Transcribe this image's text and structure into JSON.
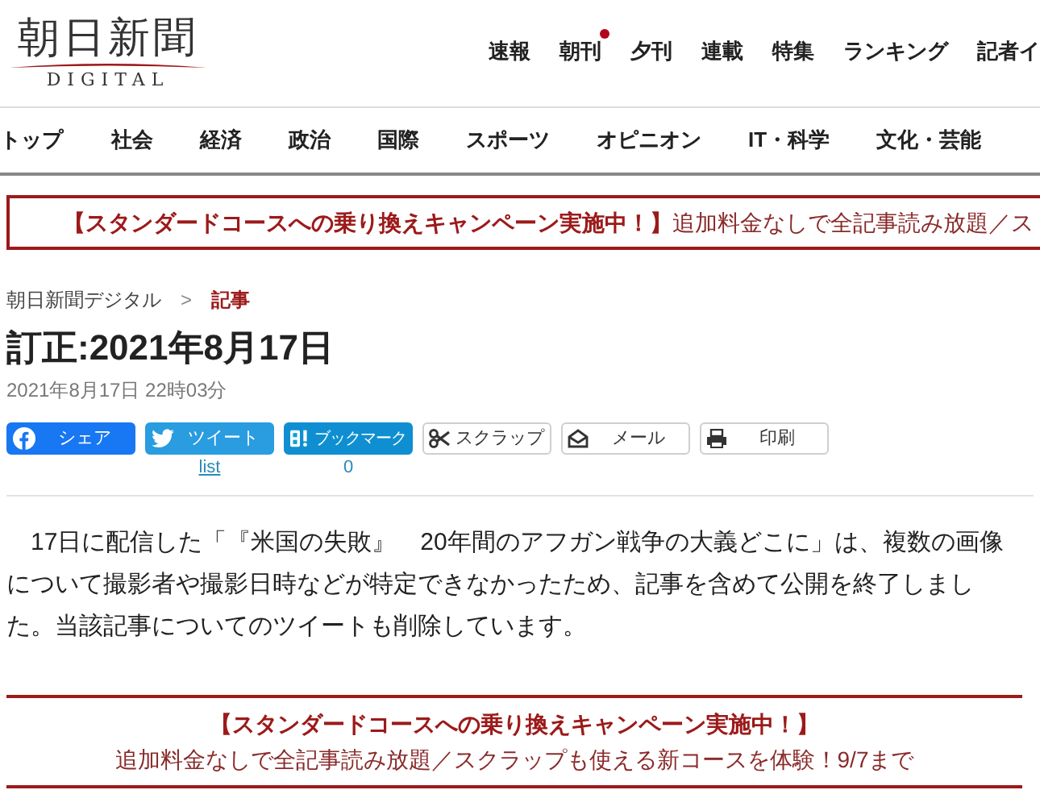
{
  "logo": {
    "title": "朝日新聞",
    "subtitle": "DIGITAL"
  },
  "top_nav": [
    {
      "label": "速報",
      "badge": false
    },
    {
      "label": "朝刊",
      "badge": true
    },
    {
      "label": "夕刊",
      "badge": false
    },
    {
      "label": "連載",
      "badge": false
    },
    {
      "label": "特集",
      "badge": false
    },
    {
      "label": "ランキング",
      "badge": false
    },
    {
      "label": "記者イ",
      "badge": false
    }
  ],
  "section_nav": [
    "トップ",
    "社会",
    "経済",
    "政治",
    "国際",
    "スポーツ",
    "オピニオン",
    "IT・科学",
    "文化・芸能"
  ],
  "banner": {
    "headline": "【スタンダードコースへの乗り換えキャンペーン実施中！】",
    "text": "追加料金なしで全記事読み放題／ス"
  },
  "breadcrumb": [
    {
      "label": "朝日新聞デジタル",
      "current": false
    },
    {
      "label": "記事",
      "current": true
    }
  ],
  "breadcrumb_separator": ">",
  "article": {
    "title": "訂正:2021年8月17日",
    "date": "2021年8月17日 22時03分",
    "body": "17日に配信した「『米国の失敗』　20年間のアフガン戦争の大義どこに」は、複数の画像について撮影者や撮影日時などが特定できなかったため、記事を含めて公開を終了しました。当該記事についてのツイートも削除しています。"
  },
  "share_buttons": [
    {
      "kind": "facebook",
      "label": "シェア"
    },
    {
      "kind": "twitter",
      "label": "ツイート",
      "count": "list"
    },
    {
      "kind": "hatena",
      "label": "ブックマーク",
      "count": "0"
    },
    {
      "kind": "scrap",
      "label": "スクラップ"
    },
    {
      "kind": "mail",
      "label": "メール"
    },
    {
      "kind": "print",
      "label": "印刷"
    }
  ],
  "promo": {
    "headline": "【スタンダードコースへの乗り換えキャンペーン実施中！】",
    "text": "追加料金なしで全記事読み放題／スクラップも使える新コースを体験！9/7まで"
  }
}
